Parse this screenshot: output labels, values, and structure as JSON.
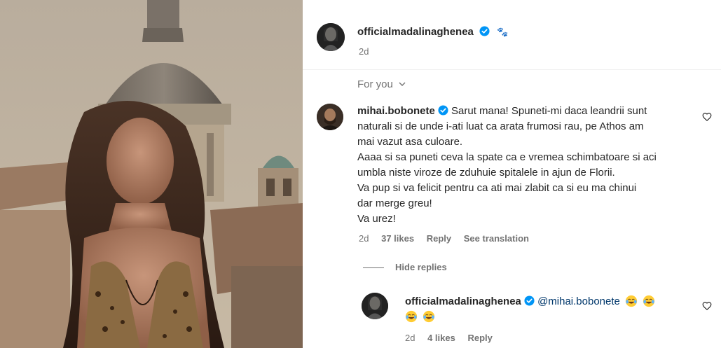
{
  "post": {
    "author": "officialmadalinaghenea",
    "time": "2d",
    "paw_icon": "🐾"
  },
  "for_you_label": "For you",
  "comments": [
    {
      "author": "mihai.bobonete",
      "lines": [
        "Sarut mana! Spuneti-mi daca leandrii sunt",
        "naturali si de unde i-ati luat ca arata frumosi rau, pe Athos am",
        "mai vazut asa culoare.",
        "Aaaa si sa puneti ceva la spate ca e vremea schimbatoare si aci",
        "umbla niste viroze de zduhuie spitalele in ajun de Florii.",
        "Va pup si va felicit pentru ca ati mai zlabit ca si eu ma chinui",
        "dar merge greu!",
        "Va urez!"
      ],
      "time": "2d",
      "likes": "37 likes",
      "reply": "Reply",
      "see_translation": "See translation"
    }
  ],
  "hide_replies_label": "Hide replies",
  "reply": {
    "author": "officialmadalinaghenea",
    "mention": "@mihai.bobonete",
    "time": "2d",
    "likes": "4 likes",
    "reply_label": "Reply"
  },
  "colors": {
    "verified": "#0095f6",
    "muted": "#737373",
    "text": "#262626",
    "mention": "#00376b"
  }
}
